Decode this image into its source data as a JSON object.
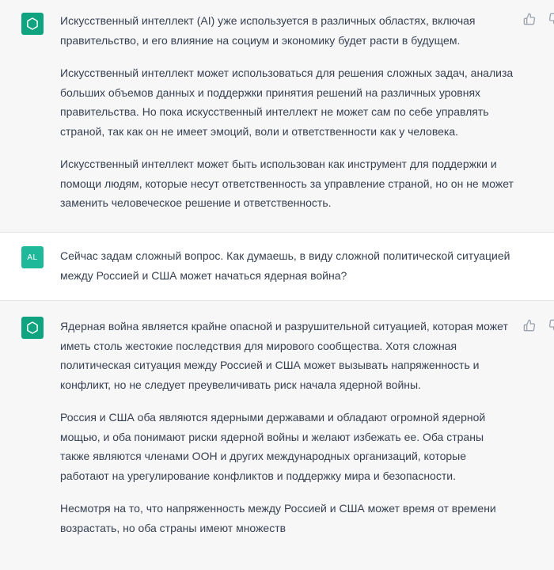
{
  "conversation": [
    {
      "role": "assistant",
      "paragraphs": [
        "Искусственный интеллект (AI) уже используется в различных областях, включая\nправительство, и его влияние на социум и экономику будет расти в будущем.",
        "Искусственный интеллект может использоваться для решения сложных задач, анализа\nбольших объемов данных и поддержки принятия решений на различных уровнях\nправительства. Но пока искусственный интеллект не может сам по себе управлять\nстраной, так как он не имеет эмоций, воли и ответственности как у человека.",
        "Искусственный интеллект может быть использован как инструмент для поддержки и\nпомощи людям, которые несут ответственность за управление страной, но он не может\nзаменить человеческое решение и ответственность."
      ]
    },
    {
      "role": "user",
      "avatar_text": "AL",
      "paragraphs": [
        "Сейчас задам сложный вопрос. Как думаешь, в виду сложной политической ситуацией\nмежду Россией и США может начаться ядерная война?"
      ]
    },
    {
      "role": "assistant",
      "paragraphs": [
        "Ядерная война является крайне опасной и разрушительной ситуацией, которая может\nиметь столь жестокие последствия для мирового сообщества. Хотя сложная\nполитическая ситуация между Россией и США может вызывать напряженность и\nконфликт, но не следует преувеличивать риск начала ядерной войны.",
        "Россия и США оба являются ядерными державами и обладают огромной ядерной\nмощью, и оба понимают риски ядерной войны и желают избежать ее. Оба страны\nтакже являются членами ООН и других международных организаций, которые\nработают на урегулирование конфликтов и поддержку мира и безопасности.",
        "Несмотря на то, что напряженность между Россией и США может время от времени\nвозрастать, но оба страны имеют множеств"
      ]
    }
  ],
  "icons": {
    "assistant_avatar": "openai-logo-icon",
    "thumbs_up": "thumbs-up-icon",
    "thumbs_down": "thumbs-down-icon"
  },
  "colors": {
    "assistant_bg": "#f7f7f8",
    "user_bg": "#ffffff",
    "gpt_avatar": "#10a37f",
    "user_avatar": "#1fb89a",
    "text": "#374151"
  }
}
